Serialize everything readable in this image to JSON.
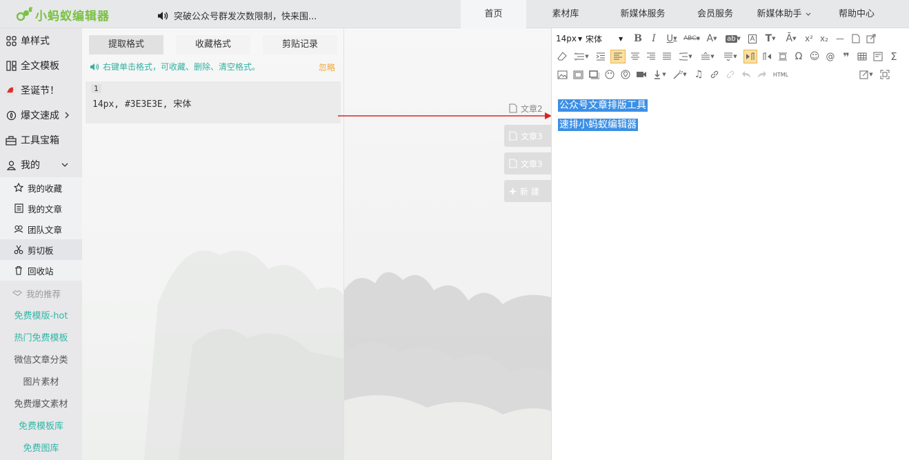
{
  "app": {
    "logo_text": "小蚂蚁编辑器"
  },
  "notice": {
    "text": "突破公众号群发次数限制，快来围..."
  },
  "nav": {
    "items": [
      "首页",
      "素材库",
      "新媒体服务",
      "会员服务",
      "新媒体助手",
      "帮助中心"
    ],
    "active": "首页"
  },
  "sidebar": {
    "items": [
      {
        "label": "单样式",
        "icon": "grid-icon"
      },
      {
        "label": "全文模板",
        "icon": "template-icon"
      },
      {
        "label": "圣诞节！",
        "icon": "santa-hat-icon"
      },
      {
        "label": "爆文速成",
        "icon": "fire-icon"
      },
      {
        "label": "工具宝箱",
        "icon": "toolbox-icon"
      },
      {
        "label": "我的",
        "icon": "user-icon"
      }
    ],
    "sub_items": [
      {
        "label": "我的收藏",
        "icon": "star-icon"
      },
      {
        "label": "我的文章",
        "icon": "doc-icon"
      },
      {
        "label": "团队文章",
        "icon": "team-icon"
      },
      {
        "label": "剪切板",
        "icon": "scissors-icon"
      },
      {
        "label": "回收站",
        "icon": "trash-icon"
      }
    ],
    "recommend": {
      "label": "我的推荐",
      "icon": "handshake-icon"
    },
    "links": [
      {
        "label": "免费模版-hot",
        "color": "#2fb8a8"
      },
      {
        "label": "热门免费模板",
        "color": "#2fb8a8"
      },
      {
        "label": "微信文章分类",
        "color": "#555555"
      },
      {
        "label": "图片素材",
        "color": "#555555"
      },
      {
        "label": "免费爆文素材",
        "color": "#555555"
      },
      {
        "label": "免费模板库",
        "color": "#2fb8a8"
      },
      {
        "label": "免费图库",
        "color": "#2fb8a8"
      }
    ]
  },
  "clipboard": {
    "tabs": [
      "提取格式",
      "收藏格式",
      "剪贴记录"
    ],
    "active_tab": "提取格式",
    "hint": "右键单击格式，可收藏、删除、清空格式。",
    "ignore_label": "忽略",
    "entry_number": "1",
    "entry_value": "14px, #3E3E3E, 宋体"
  },
  "docs": {
    "items": [
      "文章2",
      "文章3",
      "文章3"
    ],
    "new_label": "新 建"
  },
  "editor": {
    "font_size": "14px",
    "font_family": "宋体",
    "html_label": "HTML",
    "content_lines": [
      "公众号文章排版工具",
      "速排小蚂蚁编辑器"
    ]
  },
  "colors": {
    "brand": "#7ac143",
    "accent": "#2fb8a8",
    "selection": "#3b8fe6",
    "arrow": "#e02020"
  }
}
